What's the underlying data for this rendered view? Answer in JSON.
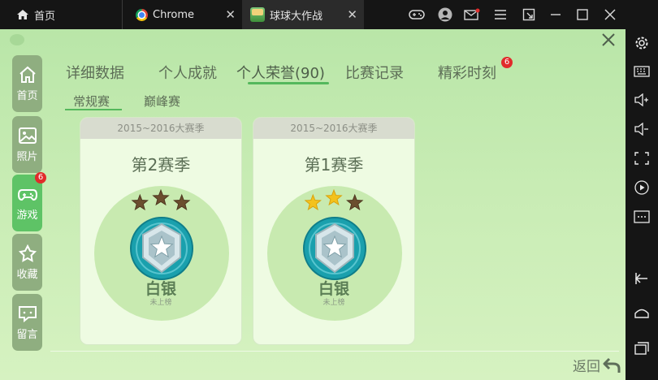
{
  "titlebar": {
    "tabs": [
      {
        "label": "首页",
        "icon": "home-icon"
      },
      {
        "label": "Chrome",
        "icon": "chrome-icon"
      },
      {
        "label": "球球大作战",
        "icon": "game-icon"
      }
    ],
    "controls": [
      "gamepad-icon",
      "user-icon",
      "mail-icon",
      "menu-icon",
      "external-icon",
      "minimize-icon",
      "maximize-icon",
      "close-icon"
    ]
  },
  "side_toolbar": [
    "settings-icon",
    "keyboard-icon",
    "volume-up-icon",
    "volume-down-icon",
    "screen-icon",
    "record-icon",
    "more-icon",
    "back-icon",
    "home-icon",
    "recent-icon"
  ],
  "left_nav": [
    {
      "label": "首页",
      "icon": "home-icon",
      "active": false
    },
    {
      "label": "照片",
      "icon": "photo-icon",
      "active": false
    },
    {
      "label": "游戏",
      "icon": "gamepad-icon",
      "active": true,
      "badge": "6"
    },
    {
      "label": "收藏",
      "icon": "star-icon",
      "active": false
    },
    {
      "label": "留言",
      "icon": "message-icon",
      "active": false
    }
  ],
  "tabs": {
    "items": [
      "详细数据",
      "个人成就",
      "个人荣誉(90)",
      "比赛记录",
      "精彩时刻"
    ],
    "active_index": 2,
    "highlight_badge": "6"
  },
  "sub_tabs": {
    "items": [
      "常规赛",
      "巅峰赛"
    ],
    "active_index": 0
  },
  "seasons": [
    {
      "header": "2015~2016大赛季",
      "title": "第2赛季",
      "stars_lit": 0,
      "stars_total": 3,
      "rank": "白银",
      "status": "未上榜"
    },
    {
      "header": "2015~2016大赛季",
      "title": "第1赛季",
      "stars_lit": 2,
      "stars_total": 3,
      "rank": "白银",
      "status": "未上榜"
    }
  ],
  "footer": {
    "back_label": "返回"
  },
  "colors": {
    "accent": "#54b85c",
    "active_nav": "#5ec366",
    "badge": "#e12b2b",
    "star_lit": "#f3c21c",
    "star_dim": "#6b4e2e",
    "rank_badge": "#1f9aa8"
  }
}
